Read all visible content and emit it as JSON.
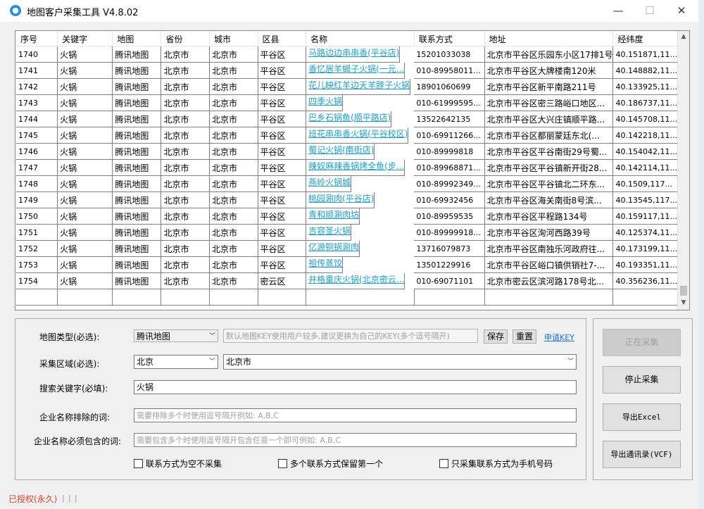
{
  "window": {
    "title": "地图客户采集工具 V4.8.02",
    "minimize": "—",
    "maximize": "☐",
    "close": "✕"
  },
  "grid": {
    "columns": [
      "序号",
      "关键字",
      "地图",
      "省份",
      "城市",
      "区县",
      "名称",
      "联系方式",
      "地址",
      "经纬度"
    ],
    "rows": [
      [
        "1740",
        "火锅",
        "腾讯地图",
        "北京市",
        "北京市",
        "平谷区",
        "马路边边串串香(平谷店)",
        "15201033038",
        "北京市平谷区乐园东小区17排1号",
        "40.151871,11..."
      ],
      [
        "1741",
        "火锅",
        "腾讯地图",
        "北京市",
        "北京市",
        "平谷区",
        "香忆居羊蝎子火锅(一元...",
        "010-89958011...",
        "北京市平谷区大牌楼南120米",
        "40.148882,11..."
      ],
      [
        "1742",
        "火锅",
        "腾讯地图",
        "北京市",
        "北京市",
        "平谷区",
        "花儿映红羊边天羊脖子火锅",
        "18901060699",
        "北京市平谷区新平南路211号",
        "40.133925,11..."
      ],
      [
        "1743",
        "火锅",
        "腾讯地图",
        "北京市",
        "北京市",
        "平谷区",
        "四季火锅",
        "010-61999595...",
        "北京市平谷区密三路峪口地区...",
        "40.186737,11..."
      ],
      [
        "1744",
        "火锅",
        "腾讯地图",
        "北京市",
        "北京市",
        "平谷区",
        "巴乡石锅鱼(顺平路店)",
        "13522642135",
        "北京市平谷区大兴庄镇顺平路...",
        "40.145708,11..."
      ],
      [
        "1745",
        "火锅",
        "腾讯地图",
        "北京市",
        "北京市",
        "平谷区",
        "班花串串香火锅(平谷校区)",
        "010-69911266...",
        "北京市平谷区都丽蒙廷东北(...",
        "40.142218,11..."
      ],
      [
        "1746",
        "火锅",
        "腾讯地图",
        "北京市",
        "北京市",
        "平谷区",
        "蜀记火锅(南街店)",
        "010-89999818",
        "北京市平谷区平谷南街29号蜀...",
        "40.154042,11..."
      ],
      [
        "1747",
        "火锅",
        "腾讯地图",
        "北京市",
        "北京市",
        "平谷区",
        "辣奴麻辣香锅烤全鱼(步...",
        "010-89968871...",
        "北京市平谷区平谷镇新开街28...",
        "40.142114,11..."
      ],
      [
        "1748",
        "火锅",
        "腾讯地图",
        "北京市",
        "北京市",
        "平谷区",
        "燕岭火锅城",
        "010-89992349...",
        "北京市平谷区平谷镇北二环东...",
        "40.1509,117..."
      ],
      [
        "1749",
        "火锅",
        "腾讯地图",
        "北京市",
        "北京市",
        "平谷区",
        "桃园涮肉(平谷店)",
        "010-69932456",
        "北京市平谷区海关南街8号滨...",
        "40.13545,117..."
      ],
      [
        "1750",
        "火锅",
        "腾讯地图",
        "北京市",
        "北京市",
        "平谷区",
        "青和顺涮肉坊",
        "010-89959535",
        "北京市平谷区平程路134号",
        "40.159117,11..."
      ],
      [
        "1751",
        "火锅",
        "腾讯地图",
        "北京市",
        "北京市",
        "平谷区",
        "吉容圣火锅",
        "010-89999918...",
        "北京市平谷区洵河西路39号",
        "40.125374,11..."
      ],
      [
        "1752",
        "火锅",
        "腾讯地图",
        "北京市",
        "北京市",
        "平谷区",
        "亿源铜锅涮肉",
        "13716079873",
        "北京市平谷区南独乐河政府往...",
        "40.173199,11..."
      ],
      [
        "1753",
        "火锅",
        "腾讯地图",
        "北京市",
        "北京市",
        "平谷区",
        "祖传蒸饺",
        "13501229916",
        "北京市平谷区峪口镇供销社7-...",
        "40.193351,11..."
      ],
      [
        "1754",
        "火锅",
        "腾讯地图",
        "北京市",
        "北京市",
        "密云区",
        "井格重庆火锅(北京密云...",
        "010-69071101",
        "北京市密云区滨河路178号北...",
        "40.356236,11..."
      ]
    ]
  },
  "form": {
    "map_type_label": "地图类型(必选):",
    "map_type_value": "腾讯地图",
    "key_placeholder": "默认地图KEY使用用户较多,建议更换为自己的KEY(多个逗号隔开)",
    "save_label": "保存",
    "reset_label": "重置",
    "apply_key_label": "申请KEY",
    "region_label": "采集区域(必选):",
    "region_value": "北京",
    "city_value": "北京市",
    "keyword_label": "搜索关键字(必填):",
    "keyword_value": "火锅",
    "exclude_label": "企业名称排除的词:",
    "exclude_placeholder": "需要排除多个时使用逗号隔开例如: A,B,C",
    "include_label": "企业名称必须包含的词:",
    "include_placeholder": "需要包含多个时使用逗号隔开包含任意一个即可例如: A,B,C",
    "opt_skip_empty": "联系方式为空不采集",
    "opt_keep_first": "多个联系方式保留第一个",
    "opt_mobile_only": "只采集联系方式为手机号码"
  },
  "buttons": {
    "collecting": "正在采集",
    "stop": "停止采集",
    "export_excel": "导出Excel",
    "export_vcf": "导出通讯录(VCF)"
  },
  "status": {
    "license": "已授权(永久)",
    "sep": "|"
  }
}
